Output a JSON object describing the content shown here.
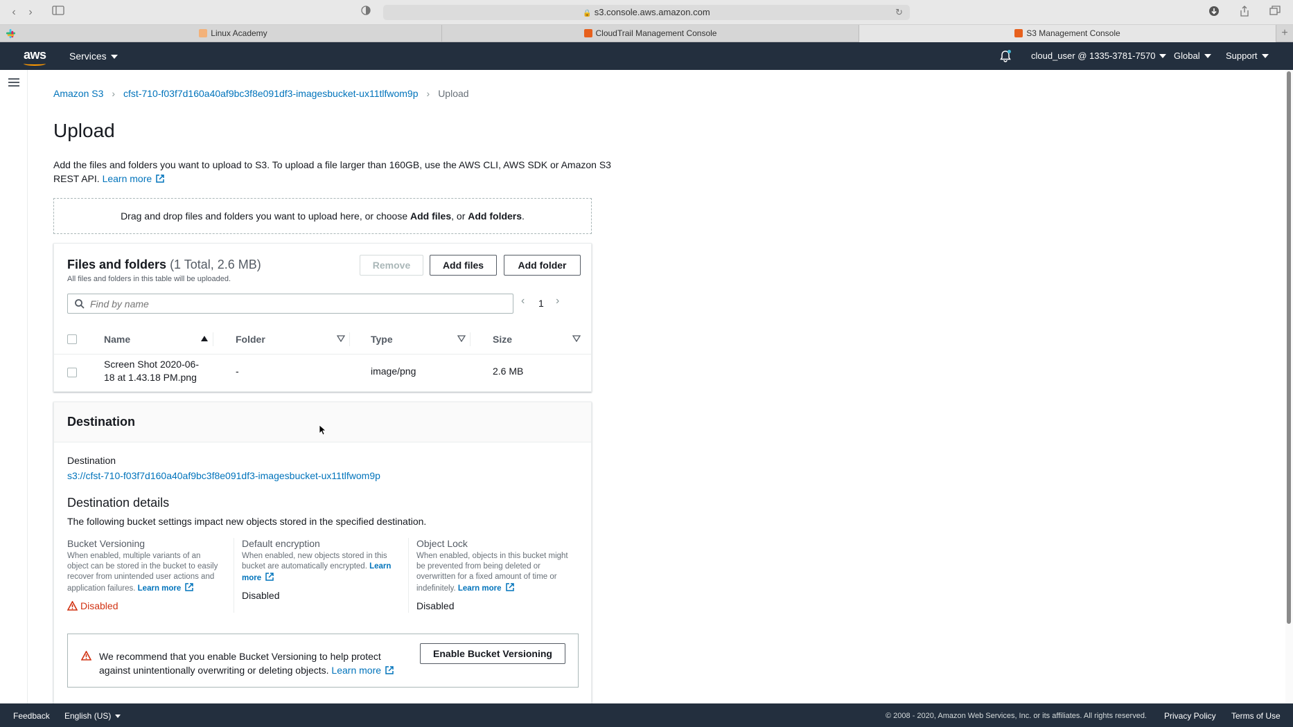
{
  "browser": {
    "url": "s3.console.aws.amazon.com",
    "tabs": [
      {
        "label": "Linux Academy"
      },
      {
        "label": "CloudTrail Management Console"
      },
      {
        "label": "S3 Management Console"
      }
    ]
  },
  "nav": {
    "services": "Services",
    "account": "cloud_user @ 1335-3781-7570",
    "region": "Global",
    "support": "Support"
  },
  "breadcrumb": {
    "root": "Amazon S3",
    "bucket": "cfst-710-f03f7d160a40af9bc3f8e091df3-imagesbucket-ux11tlfwom9p",
    "current": "Upload"
  },
  "page": {
    "title": "Upload",
    "intro": "Add the files and folders you want to upload to S3. To upload a file larger than 160GB, use the AWS CLI, AWS SDK or Amazon S3 REST API.",
    "learn_more": "Learn more"
  },
  "dropzone": {
    "prefix": "Drag and drop files and folders you want to upload here, or choose ",
    "add_files": "Add files",
    "middle": ", or ",
    "add_folders": "Add folders",
    "suffix": "."
  },
  "files": {
    "title": "Files and folders",
    "count": "(1 Total, 2.6 MB)",
    "subtitle": "All files and folders in this table will be uploaded.",
    "remove": "Remove",
    "add_files": "Add files",
    "add_folder": "Add folder",
    "search_placeholder": "Find by name",
    "page": "1",
    "columns": [
      "Name",
      "Folder",
      "Type",
      "Size"
    ],
    "rows": [
      {
        "name_line1": "Screen Shot 2020-06-",
        "name_line2": "18 at 1.43.18 PM.png",
        "folder": "-",
        "type": "image/png",
        "size": "2.6 MB"
      }
    ]
  },
  "destination": {
    "header": "Destination",
    "label": "Destination",
    "uri": "s3://cfst-710-f03f7d160a40af9bc3f8e091df3-imagesbucket-ux11tlfwom9p",
    "details_title": "Destination details",
    "details_desc": "The following bucket settings impact new objects stored in the specified destination.",
    "versioning": {
      "title": "Bucket Versioning",
      "desc": "When enabled, multiple variants of an object can be stored in the bucket to easily recover from unintended user actions and application failures.",
      "learn_more": "Learn more",
      "value": "Disabled"
    },
    "encryption": {
      "title": "Default encryption",
      "desc": "When enabled, new objects stored in this bucket are automatically encrypted.",
      "learn_more": "Learn more",
      "value": "Disabled"
    },
    "lock": {
      "title": "Object Lock",
      "desc": "When enabled, objects in this bucket might be prevented from being deleted or overwritten for a fixed amount of time or indefinitely.",
      "learn_more": "Learn more",
      "value": "Disabled"
    },
    "alert": {
      "text": "We recommend that you enable Bucket Versioning to help protect against unintentionally overwriting or deleting objects.",
      "learn_more": "Learn more",
      "button": "Enable Bucket Versioning"
    }
  },
  "footer": {
    "feedback": "Feedback",
    "language": "English (US)",
    "copyright": "© 2008 - 2020, Amazon Web Services, Inc. or its affiliates. All rights reserved.",
    "privacy": "Privacy Policy",
    "terms": "Terms of Use"
  },
  "colors": {
    "nav_bg": "#232f3e",
    "link": "#0073bb",
    "warning": "#d13212",
    "aws_orange": "#ff9900"
  }
}
